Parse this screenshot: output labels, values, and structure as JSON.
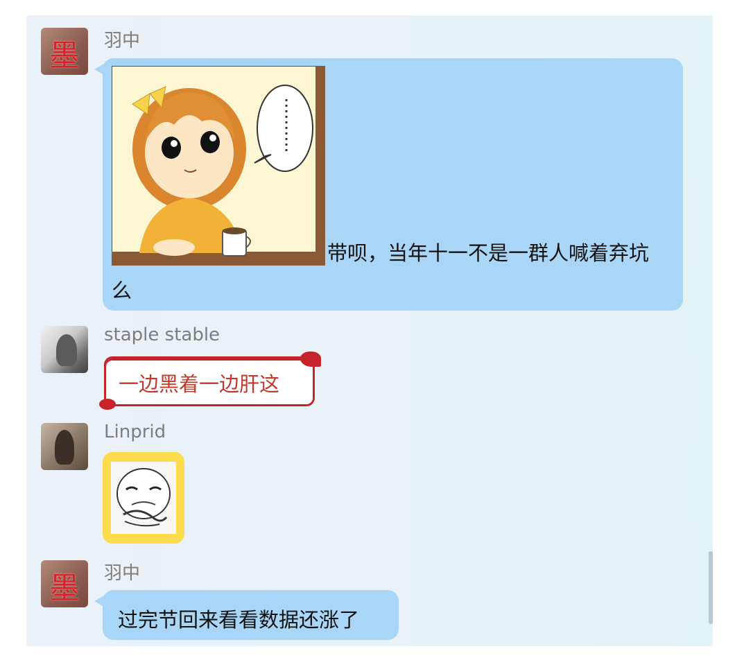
{
  "messages": [
    {
      "sender": "羽中",
      "avatar_glyph": "墨",
      "image": "anime-girl-comic-panel",
      "text_line1": "带呗，当年十一不是一群人喊着弃坑",
      "text_line2": "么"
    },
    {
      "sender": "staple stable",
      "text": "一边黑着一边肝这"
    },
    {
      "sender": "Linprid",
      "sticker": "meme-face-sticker"
    },
    {
      "sender": "羽中",
      "avatar_glyph": "墨",
      "text": "过完节回来看看数据还涨了"
    }
  ],
  "colors": {
    "bubble_blue": "#a9d6f7",
    "xmas_red": "#c7232a",
    "xmas_text": "#c0392b",
    "sticker_yellow": "#fbdc4e",
    "panel_bg": "#e8f2f7"
  }
}
